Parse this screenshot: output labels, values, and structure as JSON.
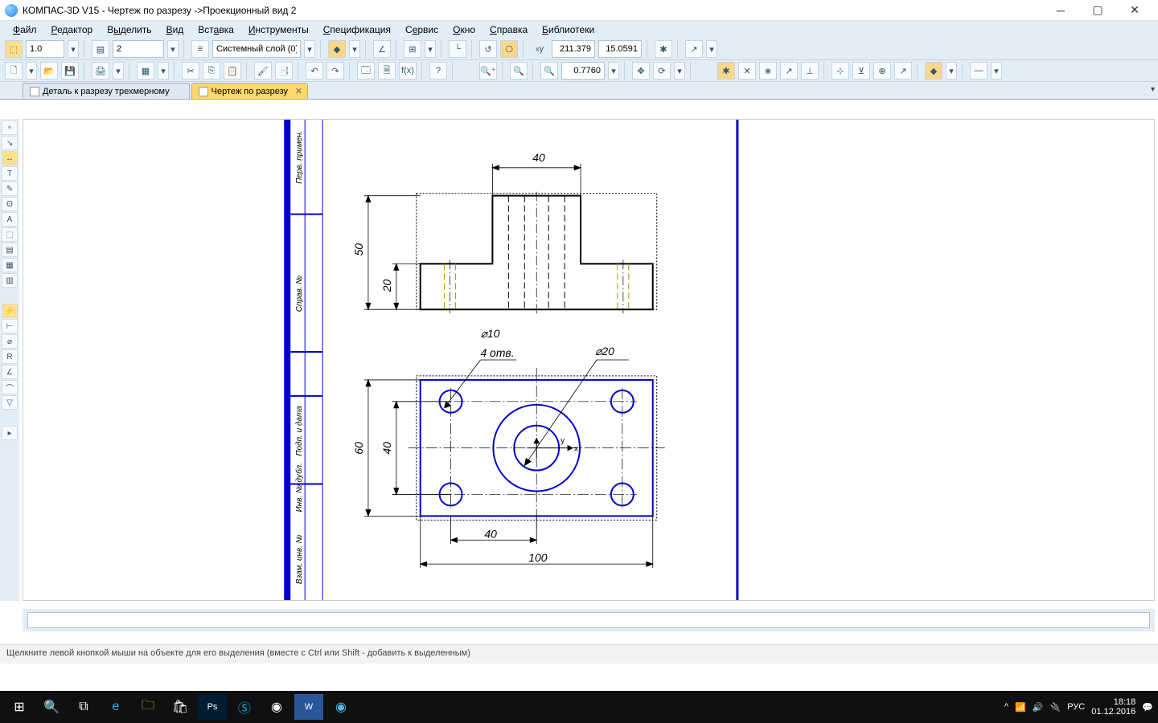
{
  "title": "КОМПАС-3D V15 - Чертеж по разрезу ->Проекционный вид 2",
  "menu": {
    "items": [
      "Файл",
      "Редактор",
      "Выделить",
      "Вид",
      "Вставка",
      "Инструменты",
      "Спецификация",
      "Сервис",
      "Окно",
      "Справка",
      "Библиотеки"
    ]
  },
  "toolbar1": {
    "scale_value": "1.0",
    "layer_num": "2",
    "layer_combo": "Системный слой (0)",
    "coord_x": "211.379",
    "coord_y": "15.0591"
  },
  "toolbar2": {
    "zoom_value": "0.7760"
  },
  "tabs": [
    {
      "label": "Деталь к разрезу трехмерному",
      "active": false
    },
    {
      "label": "Чертеж по разрезу",
      "active": true
    }
  ],
  "canvas": {
    "dims": {
      "view1_top": "40",
      "view1_h1": "50",
      "view1_h2": "20",
      "view2_d1": "⌀10",
      "view2_note": "4 отв.",
      "view2_d2": "⌀20",
      "view2_h": "60",
      "view2_h2": "40",
      "view2_w1": "40",
      "view2_w2": "100"
    },
    "axis_label_y": "y",
    "axis_label_x": "x"
  },
  "statusbar": "Щелкните левой кнопкой мыши на объекте для его выделения (вместе с Ctrl или Shift - добавить к выделенным)",
  "tray": {
    "lang": "РУС",
    "time": "18:18",
    "date": "01.12.2016"
  }
}
